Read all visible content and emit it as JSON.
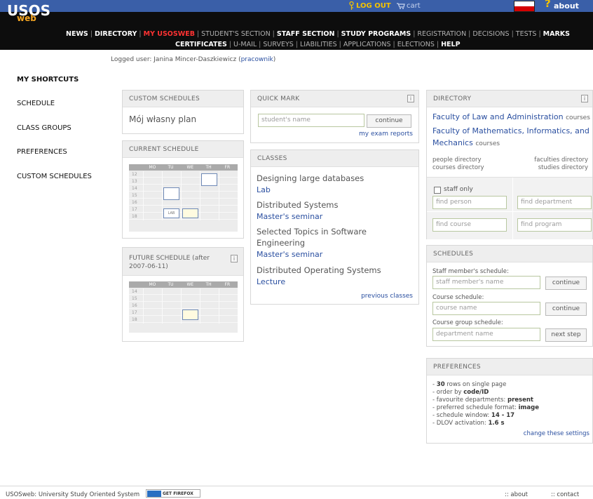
{
  "header": {
    "logo_main": "USOS",
    "logo_sub": "web",
    "logout": "LOG OUT",
    "cart": "cart",
    "about": "about"
  },
  "nav": {
    "row1": [
      "NEWS",
      "DIRECTORY",
      "MY USOSWEB",
      "STUDENT'S SECTION",
      "STAFF SECTION",
      "STUDY PROGRAMS",
      "REGISTRATION",
      "DECISIONS",
      "TESTS",
      "MARKS"
    ],
    "row2": [
      "CERTIFICATES",
      "U-MAIL",
      "SURVEYS",
      "LIABILITIES",
      "APPLICATIONS",
      "ELECTIONS",
      "HELP"
    ]
  },
  "logged": {
    "prefix": "Logged user:",
    "name": "Janina Mincer-Daszkiewicz",
    "role": "pracownik"
  },
  "sidebar": {
    "title": "MY SHORTCUTS",
    "items": [
      "SCHEDULE",
      "CLASS GROUPS",
      "PREFERENCES",
      "CUSTOM SCHEDULES"
    ]
  },
  "custom_schedules": {
    "title": "CUSTOM SCHEDULES",
    "item": "Mój własny plan"
  },
  "current_schedule": {
    "title": "CURRENT SCHEDULE",
    "days": [
      "MO",
      "TU",
      "WE",
      "TH",
      "FR"
    ],
    "hours": [
      "12",
      "13",
      "14",
      "15",
      "16",
      "17",
      "18"
    ],
    "lab_label": "LAB"
  },
  "future_schedule": {
    "title": "FUTURE SCHEDULE (after 2007-06-11)",
    "title_line1": "FUTURE SCHEDULE (after",
    "title_line2": "2007-06-11)",
    "days": [
      "MO",
      "TU",
      "WE",
      "TH",
      "FR"
    ],
    "hours": [
      "14",
      "15",
      "16",
      "17",
      "18"
    ]
  },
  "quick_mark": {
    "title": "QUICK MARK",
    "placeholder": "student's name",
    "button": "continue",
    "link": "my exam reports"
  },
  "classes": {
    "title": "CLASSES",
    "items": [
      {
        "name": "Designing large databases",
        "type": "Lab"
      },
      {
        "name": "Distributed Systems",
        "type": "Master's seminar"
      },
      {
        "name": "Selected Topics in Software Engineering",
        "name_line1": "Selected Topics in Software",
        "name_line2": "Engineering",
        "type": "Master's seminar"
      },
      {
        "name": "Distributed Operating Systems",
        "type": "Lecture"
      }
    ],
    "previous": "previous classes"
  },
  "directory": {
    "title": "DIRECTORY",
    "fac1": "Faculty of Law and Administration",
    "fac1_suffix": "courses",
    "fac2_line1": "Faculty of Mathematics, Informatics, and",
    "fac2_line2": "Mechanics",
    "fac2_suffix": "courses",
    "people": "people directory",
    "courses": "courses directory",
    "faculties": "faculties directory",
    "studies": "studies directory",
    "staff_only": "staff only",
    "find_person": "find person",
    "find_department": "find department",
    "find_course": "find course",
    "find_program": "find program"
  },
  "schedules": {
    "title": "SCHEDULES",
    "staff_label": "Staff member's schedule:",
    "staff_placeholder": "staff member's name",
    "course_label": "Course schedule:",
    "course_placeholder": "course name",
    "group_label": "Course group schedule:",
    "group_placeholder": "department name",
    "continue": "continue",
    "next": "next step"
  },
  "preferences": {
    "title": "PREFERENCES",
    "rows_pre": "- ",
    "rows_val": "30",
    "rows_post": " rows on single page",
    "order_pre": "- order by ",
    "order_val": "code/ID",
    "fav_pre": "- favourite departments: ",
    "fav_val": "present",
    "fmt_pre": "- preferred schedule format: ",
    "fmt_val": "image",
    "win_pre": "- schedule window: ",
    "win_val": "14 - 17",
    "dlov_pre": "- DLOV activation: ",
    "dlov_val": "1.6 s",
    "change": "change these settings"
  },
  "footer": {
    "system": "USOSweb: University Study Oriented System",
    "firefox": "GET FIREFOX",
    "about": ":: about",
    "contact": ":: contact"
  },
  "colors": {
    "topbar": "#3a5fa8",
    "navbar": "#0d0d0d",
    "accent_red": "#ff3232",
    "link_blue": "#2a4fa0",
    "logo_orange": "#f5a623"
  }
}
